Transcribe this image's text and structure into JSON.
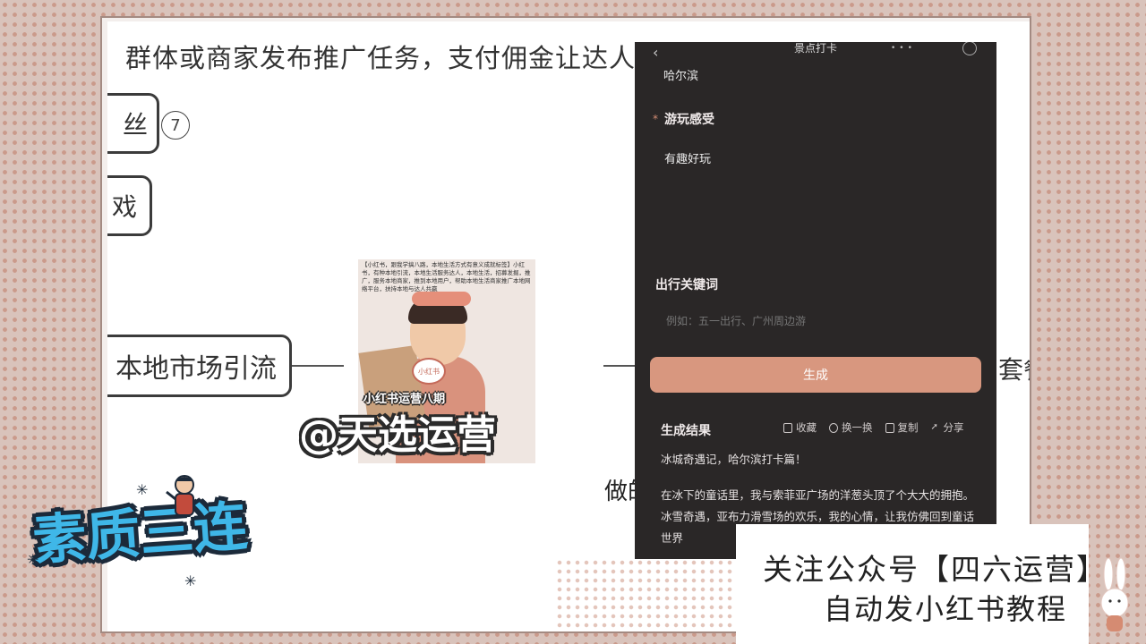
{
  "mindmap": {
    "top_line": "群体或商家发布推广任务，支付佣金让达人",
    "node_1": "丝",
    "node_1_badge": "7",
    "node_2": "戏",
    "node_3": "本地市场引流",
    "right_node": "套餐",
    "middle_text": "做的"
  },
  "thumbnail": {
    "caption": "【小红书，跟我学搞八路，本地生活方式有意义成就标签】小红书，有种本地引流，本地生活服务达人，本地生活，招募发掘，推广，服务本地商家，推到本地用户，帮助本地生活商家推广本地网络平台，扶持本地与达人共赢",
    "bubble": "小红书",
    "tag": "小红书运营八期"
  },
  "watermark": "@天选运营",
  "phone": {
    "title": "景点打卡",
    "city": "哈尔滨",
    "required_mark": "*",
    "label_experience": "游玩感受",
    "experience_value": "有趣好玩",
    "label_keywords": "出行关键词",
    "keywords_placeholder": "例如：五一出行、广州周边游",
    "generate_button": "生成",
    "result_label": "生成结果",
    "actions": {
      "favorite": "收藏",
      "refresh": "换一换",
      "copy": "复制",
      "share": "分享"
    },
    "result_title": "冰城奇遇记，哈尔滨打卡篇！",
    "result_p1": "在冰下的童话里，我与索菲亚广场的洋葱头顶了个大大的拥抱。冰雪奇遇，亚布力滑雪场的欢乐，我的心情，让我仿佛回到童话世界"
  },
  "banner": {
    "line1": "关注公众号【四六运营】",
    "line2": "自动发小红书教程"
  },
  "sticker": {
    "text": "素质三连"
  },
  "colors": {
    "accent": "#d8977f",
    "phone_bg": "#2a2727",
    "sticker_blue": "#3fb7e8"
  }
}
